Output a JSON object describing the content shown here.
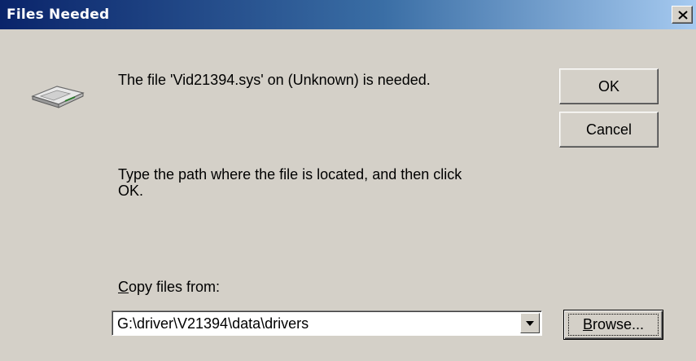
{
  "window": {
    "title": "Files Needed",
    "close_icon": "close-icon"
  },
  "message": {
    "needed": "The file 'Vid21394.sys' on (Unknown) is needed.",
    "instruction_line1": "Type the path where the file is located, and then click",
    "instruction_line2": "OK."
  },
  "copy_from": {
    "label_hotkey": "C",
    "label_rest": "opy files from:",
    "value": "G:\\driver\\V21394\\data\\drivers"
  },
  "buttons": {
    "ok": "OK",
    "cancel": "Cancel",
    "browse_hotkey": "B",
    "browse_rest": "rowse..."
  },
  "icons": {
    "drive": "disk-drive-icon",
    "dropdown": "chevron-down-icon"
  }
}
